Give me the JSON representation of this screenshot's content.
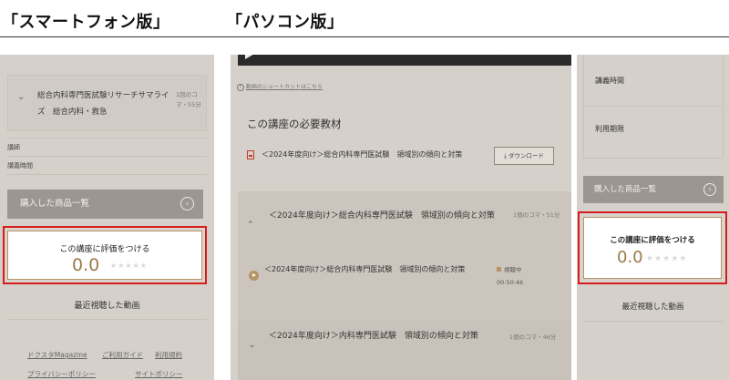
{
  "headings": {
    "smartphone": "「スマートフォン版」",
    "pc": "「パソコン版」"
  },
  "smartphone": {
    "accordion": {
      "title": "総合内科専門医試験リサーチサマライズ　総合内科・救急",
      "meta": "1回のコマ・55分"
    },
    "labels": {
      "instructor": "講師",
      "lecture_time": "講義時間"
    },
    "purchased_button": "購入した商品一覧",
    "rating": {
      "label": "この講座に評価をつける",
      "score": "0.0",
      "stars": "★★★★★"
    },
    "recent_videos": "最近視聴した動画",
    "footer": {
      "link1": "ドクスタMagazine",
      "link2": "ご利用ガイド",
      "link3": "利用規約",
      "link4": "プライバシーポリシー",
      "link5": "サイトポリシー"
    }
  },
  "pc": {
    "video": {
      "controls": "◀) ⚙ ▭ ⛶"
    },
    "shortcut_link": "動画のショートカットはこちら",
    "materials": {
      "heading": "この講座の必要教材",
      "item": "＜2024年度向け＞総合内科専門医試験　領域別の傾向と対策",
      "download_button": "⤓ ダウンロード"
    },
    "accordion1": {
      "title": "＜2024年度向け＞総合内科専門医試験　領域別の傾向と対策",
      "meta": "1個のコマ・51分"
    },
    "lesson": {
      "title": "＜2024年度向け＞総合内科専門医試験　領域別の傾向と対策",
      "status": "視聴中",
      "duration": "00:50:46"
    },
    "accordion2": {
      "title": "＜2024年度向け＞内科専門医試験　領域別の傾向と対策",
      "meta": "1個のコマ・46分"
    },
    "sidebar": {
      "lecture_time": "講義時間",
      "usage_period": "利用期限",
      "purchased_button": "購入した商品一覧",
      "rating": {
        "label": "この講座に評価をつける",
        "score": "0.0",
        "stars": "★★★★★"
      },
      "recent_videos": "最近視聴した動画"
    }
  },
  "colors": {
    "panel_bg": "#d5d0ca",
    "button_bg": "#9b968f",
    "accent_gold": "#9a7b4b",
    "highlight_red": "#d81c1c"
  }
}
